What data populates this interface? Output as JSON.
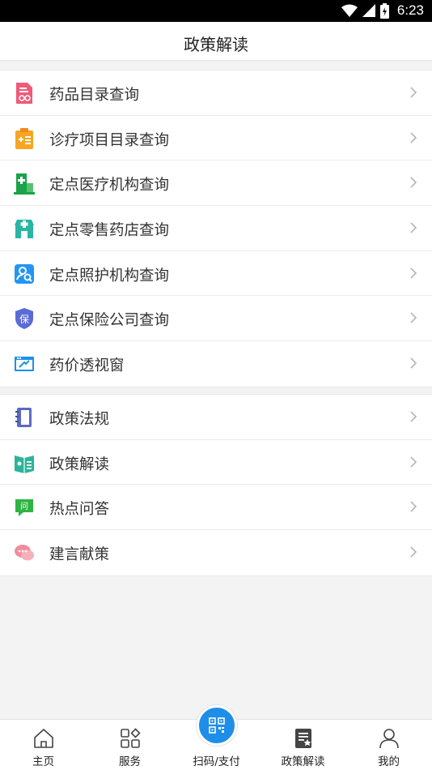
{
  "status_bar": {
    "time": "6:23"
  },
  "header": {
    "title": "政策解读"
  },
  "group1": [
    {
      "label": "药品目录查询",
      "icon": "drug-catalog-icon"
    },
    {
      "label": "诊疗项目目录查询",
      "icon": "treatment-catalog-icon"
    },
    {
      "label": "定点医疗机构查询",
      "icon": "hospital-icon"
    },
    {
      "label": "定点零售药店查询",
      "icon": "pharmacy-icon"
    },
    {
      "label": "定点照护机构查询",
      "icon": "care-institution-icon"
    },
    {
      "label": "定点保险公司查询",
      "icon": "insurance-shield-icon"
    },
    {
      "label": "药价透视窗",
      "icon": "price-window-icon"
    }
  ],
  "group2": [
    {
      "label": "政策法规",
      "icon": "regulation-book-icon"
    },
    {
      "label": "政策解读",
      "icon": "policy-book-icon"
    },
    {
      "label": "热点问答",
      "icon": "qa-chat-icon"
    },
    {
      "label": "建言献策",
      "icon": "suggestion-chat-icon"
    }
  ],
  "tabs": [
    {
      "label": "主页",
      "icon": "home-icon"
    },
    {
      "label": "服务",
      "icon": "services-grid-icon"
    },
    {
      "label": "扫码/支付",
      "icon": "qr-code-icon"
    },
    {
      "label": "政策解读",
      "icon": "policy-doc-icon",
      "active": true
    },
    {
      "label": "我的",
      "icon": "user-icon"
    }
  ]
}
